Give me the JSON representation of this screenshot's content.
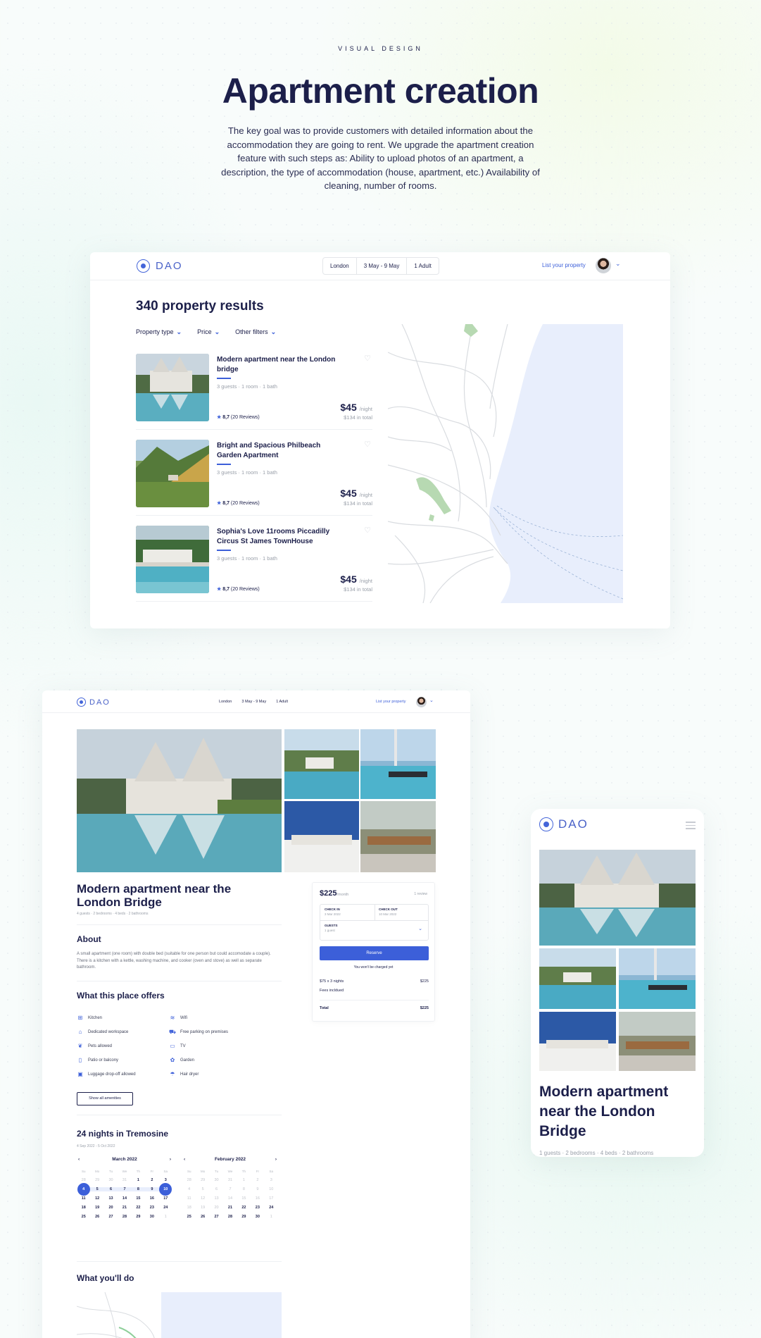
{
  "hero": {
    "eyebrow": "VISUAL DESIGN",
    "title": "Apartment creation",
    "description": "The key goal was to provide customers with detailed information about the accommodation they are going to rent. We upgrade the apartment creation feature with such steps as: Ability to upload photos of an apartment, a description, the type of accommodation (house, apartment, etc.) Availability of cleaning, number of rooms."
  },
  "nav": {
    "logo": "DAO",
    "search": {
      "location": "London",
      "dates": "3 May - 9 May",
      "guests": "1 Adult"
    },
    "list_property": "List your property"
  },
  "search_page": {
    "results_title": "340 property results",
    "filters": [
      "Property type",
      "Price",
      "Other filters"
    ],
    "listings": [
      {
        "title": "Modern apartment near the London bridge",
        "meta": "3 guests · 1 room · 1 bath",
        "price": "$45",
        "per": "/night",
        "total": "$134 in total",
        "rating": "8,7",
        "reviews": "(20 Reviews)"
      },
      {
        "title": "Bright and Spacious Philbeach Garden Apartment",
        "meta": "3 guests · 1 room · 1 bath",
        "price": "$45",
        "per": "/night",
        "total": "$134 in total",
        "rating": "8,7",
        "reviews": "(20 Reviews)"
      },
      {
        "title": "Sophia's Love 11rooms Piccadilly Circus St James TownHouse",
        "meta": "3 guests · 1 room · 1 bath",
        "price": "$45",
        "per": "/night",
        "total": "$134 in total",
        "rating": "8,7",
        "reviews": "(20 Reviews)"
      }
    ]
  },
  "detail_page": {
    "title": "Modern apartment near the London Bridge",
    "meta": "4 guests · 2 bedrooms · 4 beds · 2 bathrooms",
    "about_heading": "About",
    "about_text": "A small apartment (one room) with double bed (suitable for one person but could accomodate a couple). There is a kitchen with a kettle, washing machine, and cooker (oven and stove) as well as separate bathroom.",
    "offers_heading": "What this place offers",
    "amenities": [
      {
        "label": "Kitchen",
        "icon": "kitchen-icon"
      },
      {
        "label": "Wifi",
        "icon": "wifi-icon"
      },
      {
        "label": "Dedicated workspace",
        "icon": "workspace-icon"
      },
      {
        "label": "Free parking on premises",
        "icon": "car-icon"
      },
      {
        "label": "Pets allowed",
        "icon": "pet-icon"
      },
      {
        "label": "TV",
        "icon": "tv-icon"
      },
      {
        "label": "Patio or balcony",
        "icon": "patio-icon"
      },
      {
        "label": "Garden",
        "icon": "garden-icon"
      },
      {
        "label": "Luggage drop-off allowed",
        "icon": "luggage-icon"
      },
      {
        "label": "Hair dryer",
        "icon": "hairdryer-icon"
      }
    ],
    "show_all": "Show all amenities",
    "nights_heading": "24 nights in Tremosine",
    "date_range": "4 Sep 2022 - 5 Oct 2022",
    "calendar_left": {
      "month": "March 2022",
      "weekdays": [
        "Su",
        "Mo",
        "Tu",
        "We",
        "Th",
        "Fr",
        "Sa"
      ],
      "days": [
        "28",
        "29",
        "30",
        "31",
        "1",
        "2",
        "3",
        "4",
        "5",
        "6",
        "7",
        "8",
        "9",
        "10",
        "11",
        "12",
        "13",
        "14",
        "15",
        "16",
        "17",
        "18",
        "19",
        "20",
        "21",
        "22",
        "23",
        "24",
        "25",
        "26",
        "27",
        "28",
        "29",
        "30",
        "1"
      ]
    },
    "calendar_right": {
      "month": "February 2022",
      "weekdays": [
        "Su",
        "Mo",
        "Tu",
        "We",
        "Th",
        "Fr",
        "Sa"
      ],
      "days": [
        "28",
        "29",
        "30",
        "31",
        "1",
        "2",
        "3",
        "4",
        "5",
        "6",
        "7",
        "8",
        "9",
        "10",
        "11",
        "12",
        "13",
        "14",
        "15",
        "16",
        "17",
        "18",
        "19",
        "20",
        "21",
        "22",
        "23",
        "24",
        "25",
        "26",
        "27",
        "28",
        "29",
        "30",
        "1"
      ]
    },
    "do_heading": "What you'll do",
    "booking": {
      "price": "$225",
      "per": "/month",
      "reviews": "1 review",
      "check_in_label": "CHECK IN",
      "check_in": "3 Mar 2022",
      "check_out_label": "CHECK OUT",
      "check_out": "10 Mar 2022",
      "guests_label": "GUESTS",
      "guests": "1 guest",
      "reserve": "Reserve",
      "note": "You won't be charged yet",
      "line1_label": "$75 x 3 nights",
      "line1_value": "$225",
      "line2_label": "Fees incldued",
      "total_label": "Total",
      "total_value": "$225"
    }
  },
  "mobile": {
    "logo": "DAO",
    "title": "Modern apartment near the London Bridge",
    "meta": "1 guests · 2 bedrooms · 4 beds · 2 bathrooms"
  },
  "colors": {
    "accent": "#3c5fd9",
    "navy": "#1c1f4a",
    "water": "#e8eefc"
  }
}
